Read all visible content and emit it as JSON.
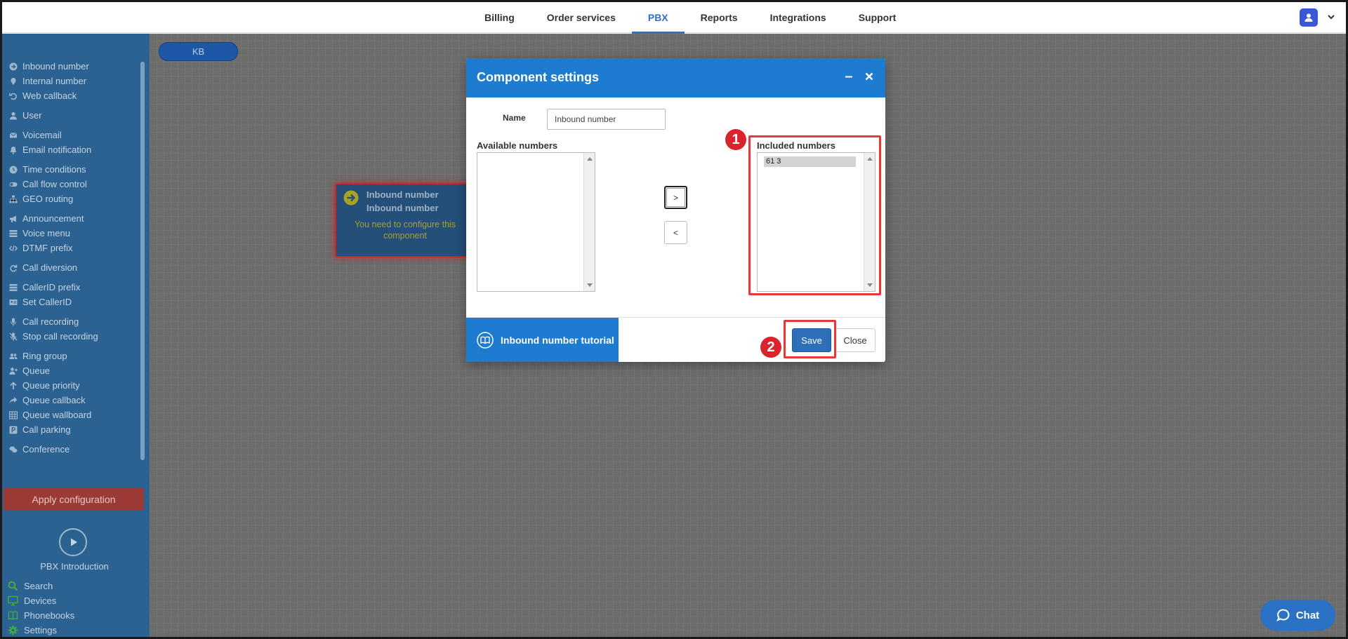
{
  "topnav": {
    "items": [
      {
        "label": "Billing"
      },
      {
        "label": "Order services"
      },
      {
        "label": "PBX"
      },
      {
        "label": "Reports"
      },
      {
        "label": "Integrations"
      },
      {
        "label": "Support"
      }
    ],
    "active": "PBX"
  },
  "sidebar": {
    "items": [
      {
        "label": "Inbound number",
        "icon": "arrow-circle-icon"
      },
      {
        "label": "Internal number",
        "icon": "map-pin-icon"
      },
      {
        "label": "Web callback",
        "icon": "undo-icon"
      },
      {
        "label": "User",
        "icon": "user-icon"
      },
      {
        "label": "Voicemail",
        "icon": "envelope-icon"
      },
      {
        "label": "Email notification",
        "icon": "bell-icon"
      },
      {
        "label": "Time conditions",
        "icon": "clock-icon"
      },
      {
        "label": "Call flow control",
        "icon": "toggle-icon"
      },
      {
        "label": "GEO routing",
        "icon": "sitemap-icon"
      },
      {
        "label": "Announcement",
        "icon": "bullhorn-icon"
      },
      {
        "label": "Voice menu",
        "icon": "list-icon"
      },
      {
        "label": "DTMF prefix",
        "icon": "code-icon"
      },
      {
        "label": "Call diversion",
        "icon": "redo-icon"
      },
      {
        "label": "CallerID prefix",
        "icon": "list-icon"
      },
      {
        "label": "Set CallerID",
        "icon": "id-card-icon"
      },
      {
        "label": "Call recording",
        "icon": "microphone-icon"
      },
      {
        "label": "Stop call recording",
        "icon": "microphone-slash-icon"
      },
      {
        "label": "Ring group",
        "icon": "users-icon"
      },
      {
        "label": "Queue",
        "icon": "user-plus-icon"
      },
      {
        "label": "Queue priority",
        "icon": "arrow-up-icon"
      },
      {
        "label": "Queue callback",
        "icon": "share-icon"
      },
      {
        "label": "Queue wallboard",
        "icon": "table-icon"
      },
      {
        "label": "Call parking",
        "icon": "parking-icon"
      },
      {
        "label": "Conference",
        "icon": "comments-icon"
      }
    ],
    "apply_label": "Apply configuration",
    "intro_label": "PBX Introduction",
    "bottom": [
      {
        "label": "Search",
        "icon": "search-icon"
      },
      {
        "label": "Devices",
        "icon": "monitor-icon"
      },
      {
        "label": "Phonebooks",
        "icon": "book-icon"
      },
      {
        "label": "Settings",
        "icon": "gear-icon"
      }
    ]
  },
  "canvas": {
    "kb_label": "KB",
    "node": {
      "title": "Inbound number",
      "subtitle": "Inbound number",
      "warning": "You need to configure this component"
    }
  },
  "dialog": {
    "title": "Component settings",
    "name_label": "Name",
    "name_value": "Inbound number",
    "available_label": "Available numbers",
    "included_label": "Included numbers",
    "included_items": [
      "61 3"
    ],
    "move_right_label": ">",
    "move_left_label": "<",
    "tutorial_label": "Inbound number tutorial",
    "save_label": "Save",
    "close_label": "Close"
  },
  "annotations": {
    "badge_1": "1",
    "badge_2": "2",
    "highlight_color": "#e23a3a"
  },
  "chat": {
    "label": "Chat"
  },
  "colors": {
    "brand_blue": "#1d7bd0",
    "sidebar_bg": "#2b6291",
    "apply_red": "#9c3a35",
    "nav_active": "#2f6fd0"
  }
}
